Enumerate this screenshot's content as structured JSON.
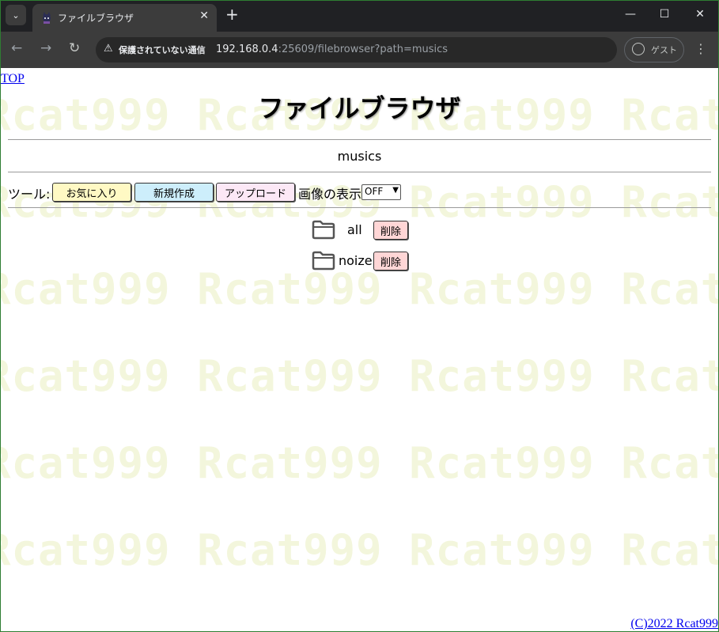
{
  "browser": {
    "tab_title": "ファイルブラウザ",
    "tab_close": "✕",
    "new_tab": "+",
    "security_warning": "保護されていない通信",
    "url_host": "192.168.0.4",
    "url_path": ":25609/filebrowser?path=musics",
    "profile_label": "ゲスト",
    "menu": "⋮",
    "minimize": "—",
    "maximize": "☐",
    "close": "✕",
    "back": "←",
    "forward": "→",
    "reload": "↻",
    "tab_list": "⌄"
  },
  "page": {
    "top_link": "TOP",
    "title": "ファイルブラウザ",
    "current_path": "musics",
    "tools_label": "ツール:",
    "favorite_button": "お気に入り",
    "new_button": "新規作成",
    "upload_button": "アップロード",
    "image_display_label": "画像の表示",
    "image_display_value": "OFF",
    "folders": [
      {
        "name": "all",
        "delete_label": "削除"
      },
      {
        "name": "noize",
        "delete_label": "削除"
      }
    ],
    "copyright": "(C)2022 Rcat999",
    "watermark_text": "Rcat999 Rcat999 Rcat999 Rcat999 Rcat999"
  },
  "colors": {
    "favorite_bg": "#fff9c4",
    "new_bg": "#cdeefb",
    "upload_bg": "#fce8f6",
    "delete_bg": "#ffd6d6",
    "watermark": "#f3f6dc"
  }
}
